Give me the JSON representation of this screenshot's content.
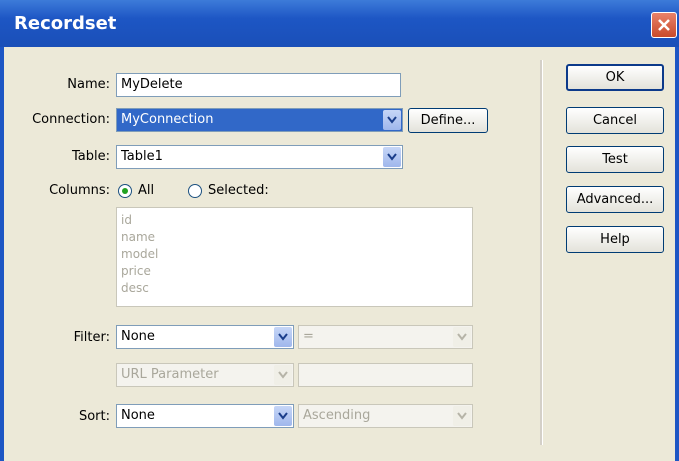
{
  "window": {
    "title": "Recordset"
  },
  "form": {
    "name_label": "Name:",
    "name_value": "MyDelete",
    "connection_label": "Connection:",
    "connection_value": "MyConnection",
    "define_label": "Define...",
    "table_label": "Table:",
    "table_value": "Table1",
    "columns_label": "Columns:",
    "columns_all_label": "All",
    "columns_selected_label": "Selected:",
    "columns_mode": "All",
    "columns_list": [
      "id",
      "name",
      "model",
      "price",
      "desc"
    ],
    "filter_label": "Filter:",
    "filter_value": "None",
    "filter_operator": "=",
    "filter_param_type": "URL Parameter",
    "filter_param_value": "",
    "sort_label": "Sort:",
    "sort_value": "None",
    "sort_order": "Ascending"
  },
  "buttons": {
    "ok": "OK",
    "cancel": "Cancel",
    "test": "Test",
    "advanced": "Advanced...",
    "help": "Help"
  }
}
